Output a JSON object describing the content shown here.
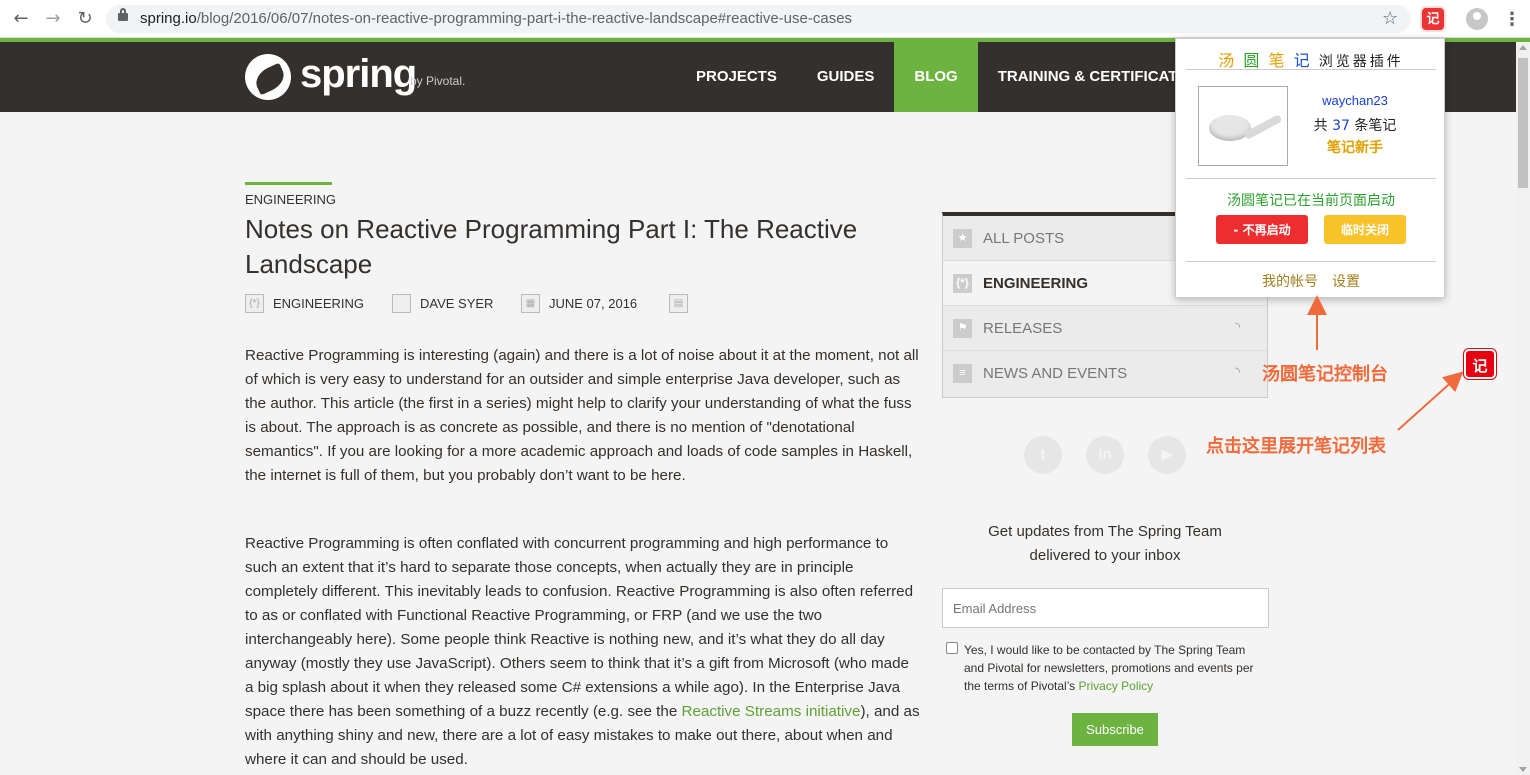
{
  "browser": {
    "back_icon": "back-arrow-icon",
    "forward_icon": "forward-arrow-icon",
    "reload_icon": "reload-icon",
    "url_host": "spring.io",
    "url_path": "/blog/2016/06/07/notes-on-reactive-programming-part-i-the-reactive-landscape#reactive-use-cases",
    "extension_label": "记"
  },
  "site": {
    "logo_text": "spring",
    "logo_by": "by Pivotal.",
    "nav": [
      "PROJECTS",
      "GUIDES",
      "BLOG",
      "TRAINING & CERTIFICATION"
    ],
    "accent_color": "#6db33f",
    "header_color": "#34302d"
  },
  "post": {
    "category": "ENGINEERING",
    "title": "Notes on Reactive Programming Part I: The Reactive Landscape",
    "meta_category": "ENGINEERING",
    "author": "DAVE SYER",
    "date": "JUNE 07, 2016",
    "p1": "Reactive Programming is interesting (again) and there is a lot of noise about it at the moment, not all of which is very easy to understand for an outsider and simple enterprise Java developer, such as the author. This article (the first in a series) might help to clarify your understanding of what the fuss is about. The approach is as concrete as possible, and there is no mention of \"denotational semantics\". If you are looking for a more academic approach and loads of code samples in Haskell, the internet is full of them, but you probably don’t want to be here.",
    "p2_before": "Reactive Programming is often conflated with concurrent programming and high performance to such an extent that it’s hard to separate those concepts, when actually they are in principle completely different. This inevitably leads to confusion. Reactive Programming is also often referred to as or conflated with Functional Reactive Programming, or FRP (and we use the two interchangeably here). Some people think Reactive is nothing new, and it’s what they do all day anyway (mostly they use JavaScript). Others seem to think that it’s a gift from Microsoft (who made a big splash about it when they released some C# extensions a while ago). In the Enterprise Java space there has been something of a buzz recently (e.g. see the ",
    "p2_link": "Reactive Streams initiative",
    "p2_after": "), and as with anything shiny and new, there are a lot of easy mistakes to make out there, about when and where it can and should be used."
  },
  "sidebar": {
    "items": [
      {
        "label": "ALL POSTS",
        "icon": "star-icon",
        "rss": false
      },
      {
        "label": "ENGINEERING",
        "icon": "engineering-icon",
        "rss": false
      },
      {
        "label": "RELEASES",
        "icon": "flag-icon",
        "rss": true
      },
      {
        "label": "NEWS AND EVENTS",
        "icon": "news-icon",
        "rss": true
      }
    ],
    "social": [
      "twitter-icon",
      "linkedin-icon",
      "youtube-icon"
    ],
    "updates_line1": "Get updates from The Spring Team",
    "updates_line2": "delivered to your inbox",
    "email_placeholder": "Email Address",
    "consent_text": "Yes, I would like to be contacted by The Spring Team and Pivotal for newsletters, promotions and events per the terms of Pivotal’s ",
    "privacy_link": "Privacy Policy",
    "subscribe_label": "Subscribe"
  },
  "popup": {
    "title_1": "汤",
    "title_2": "圆",
    "title_3": "笔",
    "title_4": "记",
    "title_rest": "浏览器插件",
    "username": "waychan23",
    "count_prefix": "共",
    "count": "37",
    "count_suffix": "条笔记",
    "rank": "笔记新手",
    "status": "汤圆笔记已在当前页面启动",
    "btn_disable": "- 不再启动",
    "btn_close": "临时关闭",
    "link_account": "我的帐号",
    "link_settings": "设置"
  },
  "annotations": {
    "console_label": "汤圆笔记控制台",
    "expand_label": "点击这里展开笔记列表",
    "float_button": "记"
  }
}
